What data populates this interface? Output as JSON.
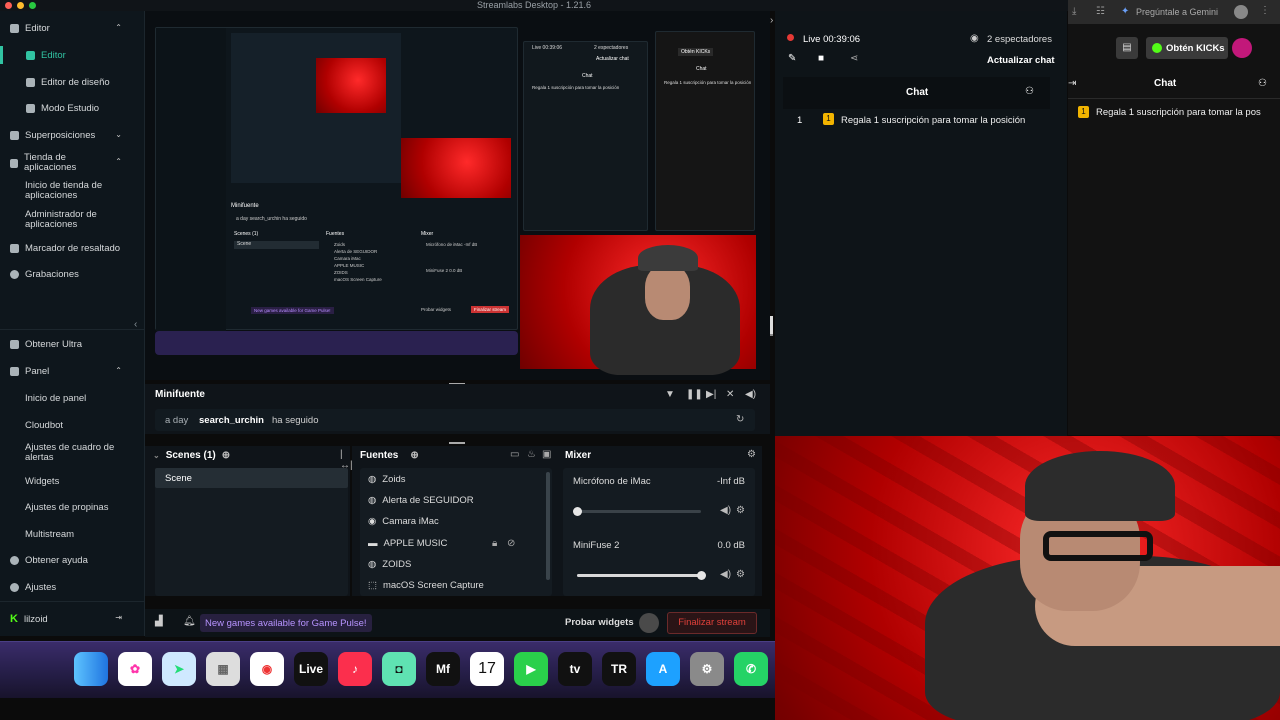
{
  "window": {
    "title": "Streamlabs Desktop - 1.21.6"
  },
  "sidebar": {
    "items": [
      {
        "label": "Editor"
      },
      {
        "label": "Editor"
      },
      {
        "label": "Editor de diseño"
      },
      {
        "label": "Modo Estudio"
      },
      {
        "label": "Superposiciones"
      },
      {
        "label": "Tienda de aplicaciones"
      },
      {
        "label": "Inicio de tienda de aplicaciones"
      },
      {
        "label": "Administrador de aplicaciones"
      },
      {
        "label": "Marcador de resaltado"
      },
      {
        "label": "Grabaciones"
      },
      {
        "label": "Obtener Ultra"
      },
      {
        "label": "Panel"
      },
      {
        "label": "Inicio de panel"
      },
      {
        "label": "Cloudbot"
      },
      {
        "label": "Ajustes de cuadro de alertas"
      },
      {
        "label": "Widgets"
      },
      {
        "label": "Ajustes de propinas"
      },
      {
        "label": "Multistream"
      },
      {
        "label": "Obtener ayuda"
      },
      {
        "label": "Ajustes"
      },
      {
        "label": "lilzoid"
      }
    ]
  },
  "preview": {
    "nested": {
      "minifuente": "Minifuente",
      "ago": "a day",
      "user": "search_urchin",
      "action": "ha seguido",
      "scenes": "Scenes (1)",
      "scene": "Scene",
      "fuentes": "Fuentes",
      "mixer": "Mixer",
      "sources": [
        "Zoids",
        "Alerta de SEGUIDOR",
        "Camara iMac",
        "APPLE MUSIC",
        "ZOIDS",
        "macOS Screen Capture"
      ],
      "mic": "Micrófono de iMac",
      "mic_db": "-Inf dB",
      "fuse": "MiniFuse 2",
      "fuse_db": "0.0 dB",
      "notice": "New games available for Game Pulse!",
      "probar": "Probar widgets",
      "finalizar": "Finalizar stream",
      "live_time": "Live 00:39:06",
      "viewers": "2 espectadores",
      "actualizar": "Actualizar chat",
      "chat": "Chat",
      "chat_line": "Regala 1 suscripción para tomar la posición",
      "obten": "Obtén KICKs"
    }
  },
  "minifuente": {
    "title": "Minifuente",
    "time_ago": "a day",
    "username": "search_urchin",
    "action": "ha seguido"
  },
  "scenes": {
    "title": "Scenes (1)",
    "items": [
      "Scene"
    ]
  },
  "sources": {
    "title": "Fuentes",
    "items": [
      "Zoids",
      "Alerta de SEGUIDOR",
      "Camara iMac",
      "APPLE MUSIC",
      "ZOIDS",
      "macOS Screen Capture"
    ]
  },
  "mixer": {
    "title": "Mixer",
    "channels": [
      {
        "name": "Micrófono de iMac",
        "db": "-Inf dB",
        "level": 0.0
      },
      {
        "name": "MiniFuse 2",
        "db": "0.0 dB",
        "level": 1.0
      }
    ]
  },
  "bottom": {
    "notice": "New games available for Game Pulse!",
    "test_widgets": "Probar widgets",
    "end_stream": "Finalizar stream"
  },
  "dock": {
    "apps": [
      "Finder",
      "Fotos",
      "Maps",
      "Launchpad",
      "Chrome",
      "Live",
      "Music",
      "App",
      "Mf",
      "17",
      "FaceTime",
      "tv",
      "TR",
      "App Store",
      "Ajustes",
      "WhatsApp"
    ],
    "date_label": "17"
  },
  "live": {
    "status": "Live",
    "time": "00:39:06",
    "viewers": "2 espectadores",
    "refresh": "Actualizar chat",
    "chat_title": "Chat",
    "messages": [
      {
        "num": "1",
        "text": "Regala 1 suscripción para tomar la posición"
      }
    ]
  },
  "browser": {
    "gemini": "Pregúntale a Gemini",
    "kicks": "Obtén KICKs",
    "chat_title": "Chat",
    "message": "Regala 1 suscripción para tomar la pos"
  },
  "colors": {
    "accent": "#31c3a2",
    "live_red": "#e53935",
    "end_stream": "#e0403a",
    "kick_green": "#53fc18"
  }
}
